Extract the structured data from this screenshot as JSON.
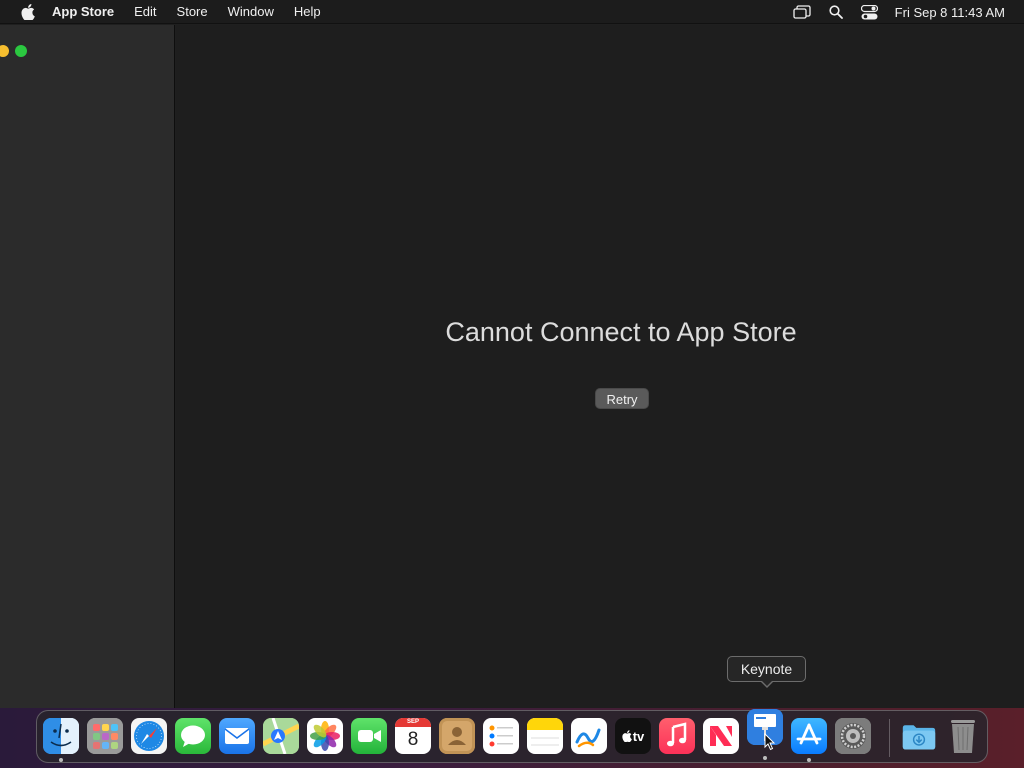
{
  "menubar": {
    "app_name": "App Store",
    "items": [
      "Edit",
      "Store",
      "Window",
      "Help"
    ],
    "clock": "Fri Sep 8  11:43 AM"
  },
  "main": {
    "error_title": "Cannot Connect to App Store",
    "retry_label": "Retry"
  },
  "tooltip": {
    "label": "Keynote"
  },
  "dock": {
    "calendar_month": "SEP",
    "calendar_day": "8",
    "tv_label": "tv",
    "icons": [
      "finder-icon",
      "launchpad-icon",
      "safari-icon",
      "messages-icon",
      "mail-icon",
      "maps-icon",
      "photos-icon",
      "facetime-icon",
      "calendar-icon",
      "contacts-icon",
      "reminders-icon",
      "notes-icon",
      "freeform-icon",
      "tv-icon",
      "music-icon",
      "news-icon",
      "keynote-icon",
      "app-store-icon",
      "system-settings-icon",
      "downloads-folder-icon",
      "trash-icon"
    ]
  },
  "colors": {
    "traffic_yellow": "#f6be2f",
    "traffic_green": "#2bc840",
    "background": "#1e1e1e",
    "sidebar": "#2b2b2b"
  }
}
